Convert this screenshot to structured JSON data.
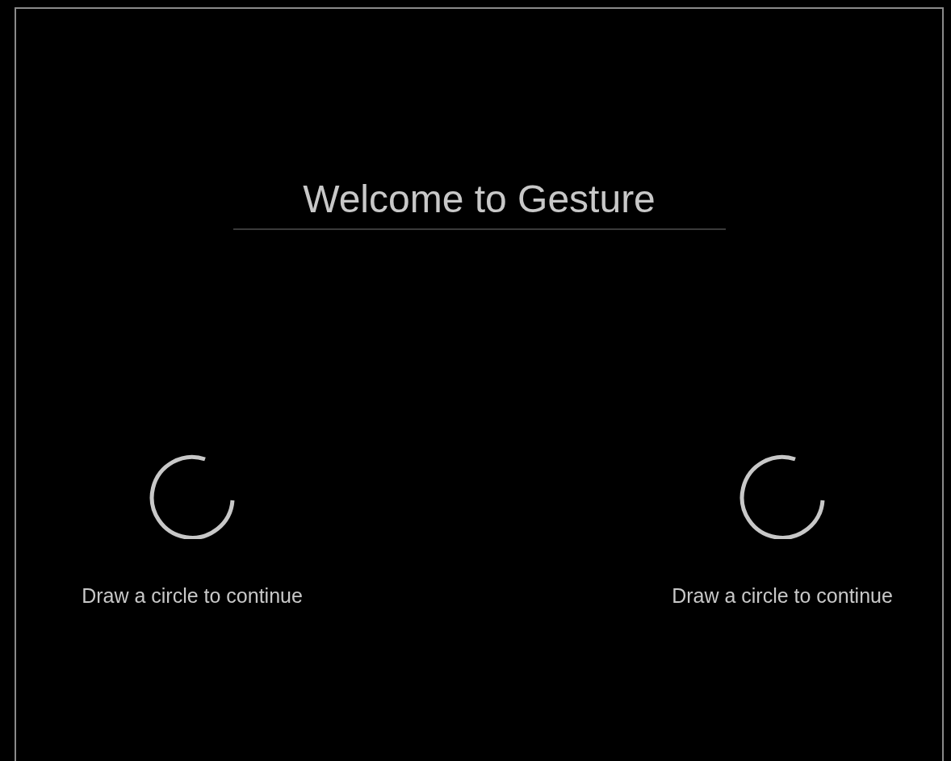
{
  "title": "Welcome to Gesture",
  "prompts": [
    {
      "text": "Draw a circle to continue"
    },
    {
      "text": "Draw a circle to continue"
    }
  ]
}
